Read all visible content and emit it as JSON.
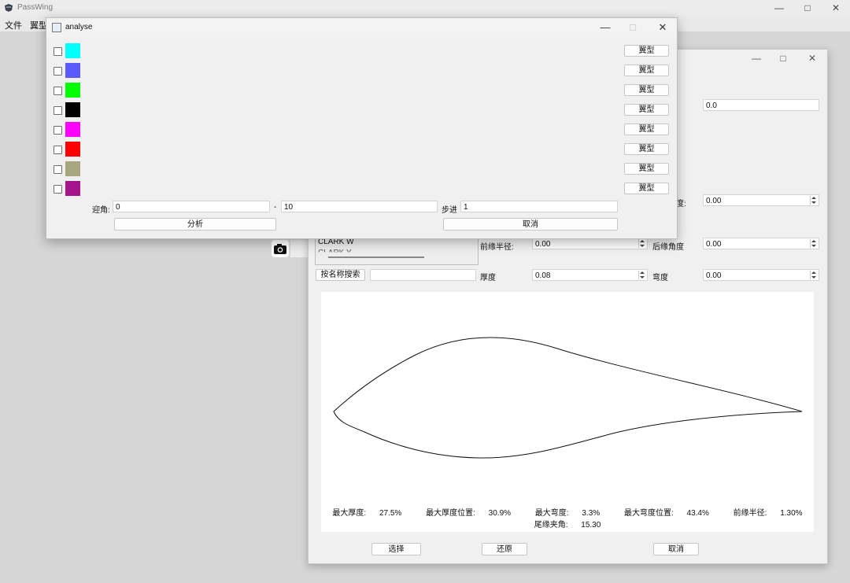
{
  "app": {
    "title": "PassWing"
  },
  "menu": {
    "items": [
      "文件",
      "翼型"
    ]
  },
  "editor": {
    "top_field_value": "0.0",
    "row_a": {
      "label_fragment": "度:",
      "value": "0.00"
    },
    "list_items": [
      "CLARK W",
      "CLARK Y"
    ],
    "leading_radius": {
      "label": "前缘半径:",
      "value": "0.00"
    },
    "trailing_angle": {
      "label": "后缘角度",
      "value": "0.00"
    },
    "search": {
      "button": "按名称搜索",
      "value": ""
    },
    "thickness": {
      "label": "厚度",
      "value": "0.08"
    },
    "camber": {
      "label": "弯度",
      "value": "0.00"
    },
    "stats": [
      {
        "label": "最大厚度:",
        "value": "27.5%"
      },
      {
        "label": "最大厚度位置:",
        "value": "30.9%"
      },
      {
        "label": "最大弯度:",
        "value": "3.3%"
      },
      {
        "label": "最大弯度位置:",
        "value": "43.4%"
      },
      {
        "label": "前缘半径:",
        "value": "1.30%"
      },
      {
        "label": "尾缘夹角:",
        "value": "15.30"
      }
    ],
    "buttons": {
      "select": "选择",
      "restore": "还原",
      "cancel": "取消"
    }
  },
  "analyse": {
    "title": "analyse",
    "rows": [
      {
        "color": "#00ffff",
        "button": "翼型"
      },
      {
        "color": "#5a5aff",
        "button": "翼型"
      },
      {
        "color": "#00ff00",
        "button": "翼型"
      },
      {
        "color": "#000000",
        "button": "翼型"
      },
      {
        "color": "#ff00ff",
        "button": "翼型"
      },
      {
        "color": "#ff0000",
        "button": "翼型"
      },
      {
        "color": "#a8a67e",
        "button": "翼型"
      },
      {
        "color": "#a6138a",
        "button": "翼型"
      }
    ],
    "angle": {
      "label": "迎角:",
      "from": "0",
      "separator": "-",
      "to": "10"
    },
    "step": {
      "label": "步进",
      "value": "1"
    },
    "buttons": {
      "analyse": "分析",
      "cancel": "取消"
    }
  }
}
